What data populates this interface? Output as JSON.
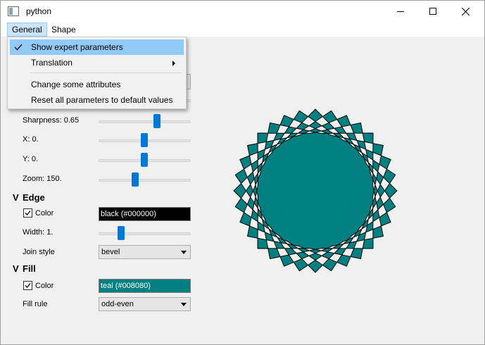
{
  "window": {
    "title": "python",
    "icon": "app-window-icon"
  },
  "menubar": {
    "items": [
      {
        "label": "General",
        "active": true
      },
      {
        "label": "Shape",
        "active": false
      }
    ]
  },
  "dropdown": {
    "items": [
      {
        "label": "Show expert parameters",
        "checked": true,
        "submenu": false
      },
      {
        "label": "Translation",
        "checked": false,
        "submenu": true
      },
      {
        "label": "Change some attributes",
        "checked": false,
        "submenu": false
      },
      {
        "label": "Reset all parameters to default values",
        "checked": false,
        "submenu": false
      }
    ]
  },
  "params": {
    "sharpness": {
      "label": "Sharpness: 0.65",
      "level": 0.65
    },
    "x": {
      "label": "X: 0.",
      "level": 0.5
    },
    "y": {
      "label": "Y: 0.",
      "level": 0.5
    },
    "zoom": {
      "label": "Zoom: 150.",
      "level": 0.4
    }
  },
  "edge": {
    "section": "Edge",
    "color_label": "Color",
    "color_checked": true,
    "color_value": "black (#000000)",
    "color_hex": "#000000",
    "width": {
      "label": "Width: 1.",
      "level": 0.25
    },
    "join_label": "Join style",
    "join_value": "bevel"
  },
  "fill": {
    "section": "Fill",
    "color_label": "Color",
    "color_checked": true,
    "color_value": "teal (#008080)",
    "color_hex": "#008080",
    "rule_label": "Fill rule",
    "rule_value": "odd-even"
  },
  "shape": {
    "points": 32,
    "fill_rule": "evenodd",
    "fill": "#008080",
    "stroke": "#000000",
    "sharpness": 0.65
  }
}
